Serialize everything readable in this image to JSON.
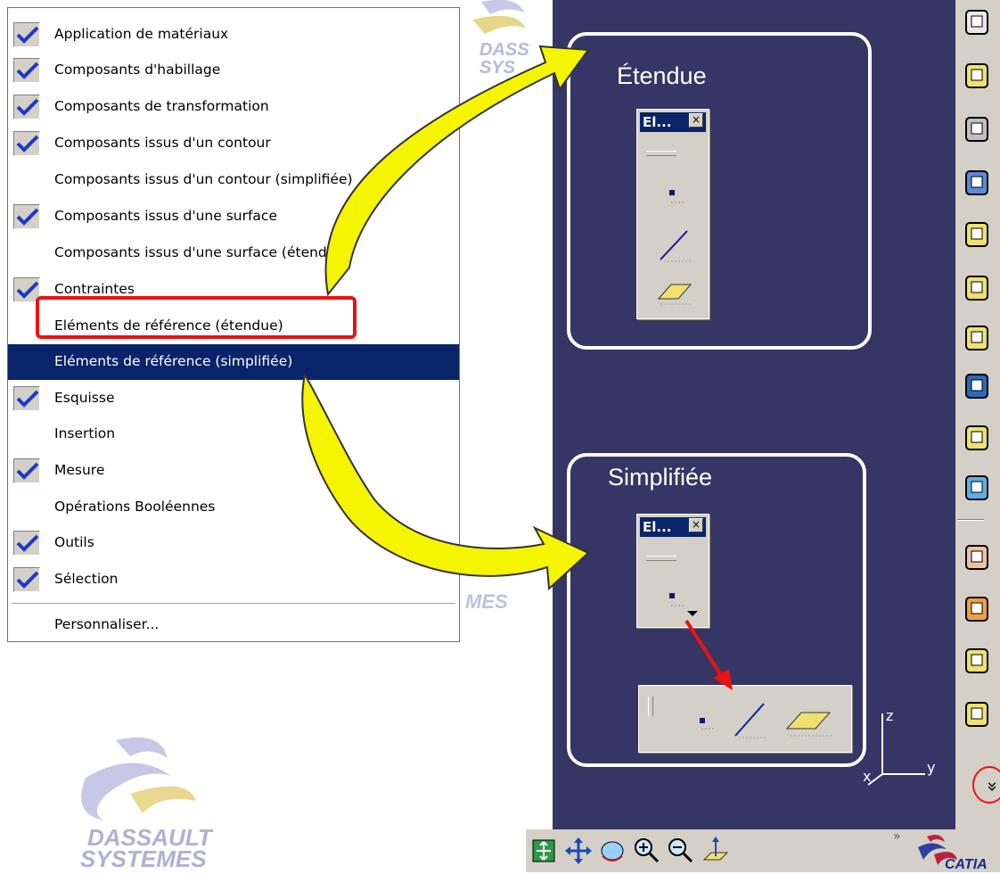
{
  "menu": {
    "items": [
      {
        "label": "Application de matériaux",
        "checked": true
      },
      {
        "label": "Composants d'habillage",
        "checked": true
      },
      {
        "label": "Composants de transformation",
        "checked": true
      },
      {
        "label": "Composants issus d'un contour",
        "checked": true
      },
      {
        "label": "Composants issus d'un contour (simplifiée)",
        "checked": false
      },
      {
        "label": "Composants issus d'une surface",
        "checked": true
      },
      {
        "label": "Composants issus d'une surface (étendue)",
        "checked": false
      },
      {
        "label": "Contraintes",
        "checked": true
      },
      {
        "label": "Eléments de référence (étendue)",
        "checked": false
      },
      {
        "label": "Eléments de référence (simplifiée)",
        "checked": false,
        "highlighted": true
      },
      {
        "label": "Esquisse",
        "checked": true
      },
      {
        "label": "Insertion",
        "checked": false
      },
      {
        "label": "Mesure",
        "checked": true
      },
      {
        "label": "Opérations Booléennes",
        "checked": false
      },
      {
        "label": "Outils",
        "checked": true
      },
      {
        "label": "Sélection",
        "checked": true
      }
    ],
    "customize": "Personnaliser..."
  },
  "panels": {
    "extended": {
      "title": "Étendue",
      "toolbar_title": "El..."
    },
    "simplified": {
      "title": "Simplifiée",
      "toolbar_title": "El..."
    }
  },
  "toolbar_close_glyph": "×",
  "watermark": {
    "line1": "DASSAULT",
    "line2": "SYSTEMES",
    "small1": "DASS",
    "small2": "SYS",
    "small3": "MES"
  },
  "axis": {
    "z": "z",
    "y": "y",
    "x": "x"
  },
  "catia_logo": "CATIA",
  "more_chevron": "»",
  "colors": {
    "menu_highlight": "#0a246a",
    "viewer_bg": "#353566",
    "callout_red": "#ee1111",
    "arrow_yellow": "#f5f500",
    "check_blue": "#1a3ac8"
  },
  "icons": {
    "right_toolbar": [
      "pad-icon",
      "pocket-icon",
      "shaft-icon",
      "groove-icon",
      "hole-icon",
      "rib-icon",
      "slot-icon",
      "stiffener-icon",
      "multi-section-solid-icon",
      "removed-multi-section-solid-icon",
      "fillet-icon",
      "chamfer-icon",
      "draft-icon",
      "shell-icon",
      "more-tools-icon"
    ],
    "bottom_toolbar": [
      "fit-all-icon",
      "pan-icon",
      "rotate-icon",
      "zoom-in-icon",
      "zoom-out-icon",
      "normal-view-icon"
    ]
  }
}
